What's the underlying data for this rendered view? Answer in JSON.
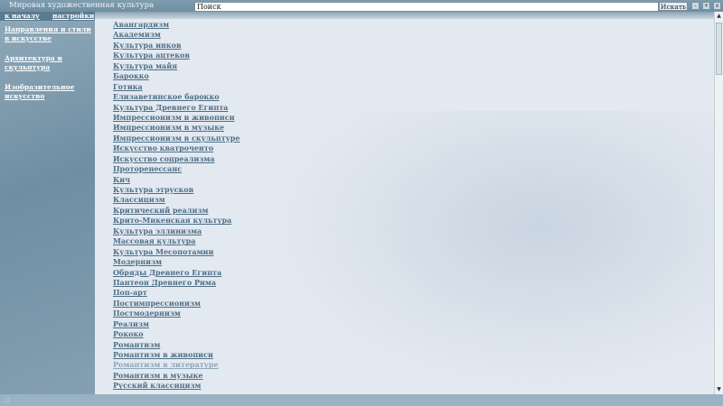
{
  "header": {
    "title": "Мировая художественная культура",
    "search_placeholder": "Поиск",
    "search_button": "Искать",
    "window_buttons": [
      "-",
      "+",
      "x"
    ]
  },
  "sidebar": {
    "nav": {
      "home": "к началу",
      "settings": "настройки"
    },
    "sections": [
      "Направления и стили в искусстве",
      "Архитектура и скульптура",
      "Изобразительное искусство"
    ]
  },
  "styles_list": [
    "Авангардизм",
    "Академизм",
    "Культура инков",
    "Культура ацтеков",
    "Культура майя",
    "Барокко",
    "Готика",
    "Елизаветинское барокко",
    "Культура Древнего Египта",
    "Импрессионизм в живописи",
    "Импрессионизм в музыке",
    "Импрессионизм в скульптуре",
    "Искусство кватроченто",
    "Искусство соцреализма",
    "Проторенессанс",
    "Кич",
    "Культура этрусков",
    "Классицизм",
    "Критический реализм",
    "Крито-Микенская культура",
    "Культура эллинизма",
    "Массовая культура",
    "Культура Месопотамии",
    "Модернизм",
    "Обряды Древнего Египта",
    "Пантеон Древнего Рима",
    "Поп-арт",
    "Постимпрессионизм",
    "Постмодернизм",
    "Реализм",
    "Рококо",
    "Романтизм",
    "Романтизм в живописи",
    "Романтизм в литературе",
    "Романтизм в музыке",
    "Русский классицизм"
  ],
  "visited_item": "Романтизм в литературе",
  "colors": {
    "link": "#4e6f86",
    "visited_link": "#8fa6b8",
    "header_bg": "#6f8ea2",
    "main_bg": "#e3e9f1"
  },
  "icons": {
    "scroll_up": "up-arrow-icon",
    "scroll_down": "down-arrow-icon",
    "corner": "resize-grip-icon"
  }
}
